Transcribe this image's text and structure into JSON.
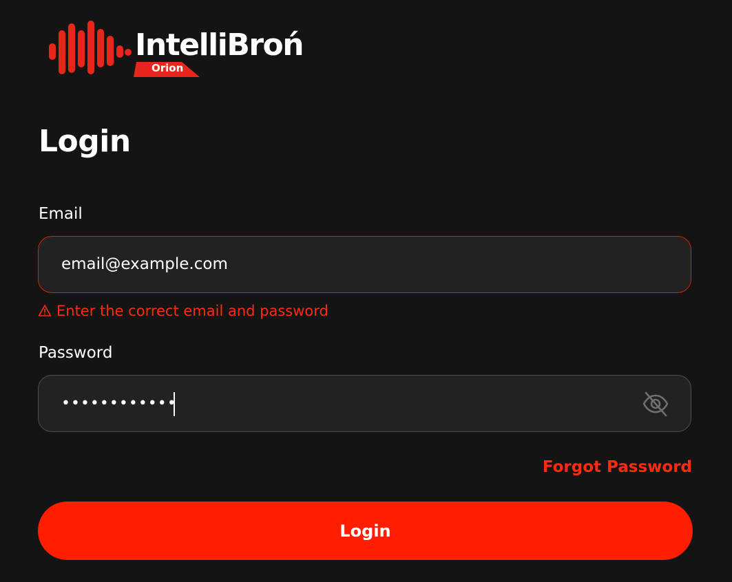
{
  "brand": {
    "name": "IntelliBroń",
    "subtitle": "Orion",
    "accent_color": "#ff1e00",
    "background_color": "#141414"
  },
  "page": {
    "title": "Login"
  },
  "form": {
    "email_label": "Email",
    "email_value": "email@example.com",
    "error_icon": "warning-triangle-icon",
    "error_message": "Enter the correct email and password",
    "password_label": "Password",
    "password_value": "••••••••••••",
    "password_toggle_icon": "eye-off-icon",
    "forgot_password_label": "Forgot Password",
    "submit_label": "Login"
  }
}
